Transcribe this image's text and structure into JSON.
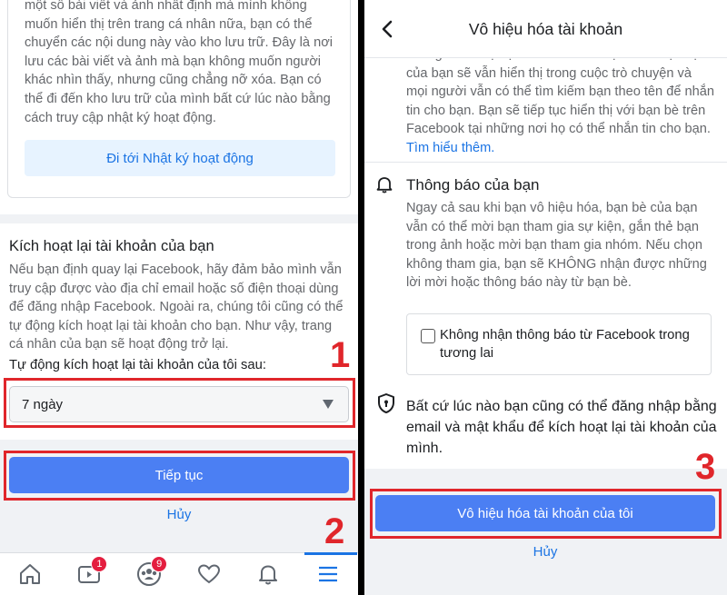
{
  "left_screen": {
    "intro_text": "một số bài viết và ảnh nhất định mà mình không muốn hiển thị trên trang cá nhân nữa, bạn có thể chuyển các nội dung này vào kho lưu trữ. Đây là nơi lưu các bài viết và ảnh mà bạn không muốn người khác nhìn thấy, nhưng cũng chẳng nỡ xóa. Bạn có thể đi đến kho lưu trữ của mình bất cứ lúc nào bằng cách truy cập nhật ký hoạt động.",
    "activity_log_button": "Đi tới Nhật ký hoạt động",
    "reactivate_title": "Kích hoạt lại tài khoản của bạn",
    "reactivate_text": "Nếu bạn định quay lại Facebook, hãy đảm bảo mình vẫn truy cập được vào địa chỉ email hoặc số điện thoại dùng để đăng nhập Facebook. Ngoài ra, chúng tôi cũng có thể tự động kích hoạt lại tài khoản cho bạn. Như vậy, trang cá nhân của bạn sẽ hoạt động trở lại.",
    "auto_reactivate_label": "Tự động kích hoạt lại tài khoản của tôi sau:",
    "selected_option": "7 ngày",
    "continue_button": "Tiếp tục",
    "cancel_link": "Hủy",
    "callout_1": "1",
    "callout_2": "2",
    "nav": {
      "watch_badge": "1",
      "groups_badge": "9"
    }
  },
  "right_screen": {
    "title": "Vô hiệu hóa tài khoản",
    "profile_text": "không kích hoạt lại tài khoản của bạn. Ảnh đại diện của bạn sẽ vẫn hiển thị trong cuộc trò chuyện và mọi người vẫn có thể tìm kiếm bạn theo tên để nhắn tin cho bạn. Bạn sẽ tiếp tục hiển thị với bạn bè trên Facebook tại những nơi họ có thể nhắn tin cho bạn. ",
    "learn_more_link": "Tìm hiểu thêm.",
    "notif_title": "Thông báo của bạn",
    "notif_text": "Ngay cả sau khi bạn vô hiệu hóa, bạn bè của bạn vẫn có thể mời bạn tham gia sự kiện, gắn thẻ bạn trong ảnh hoặc mời bạn tham gia nhóm. Nếu chọn không tham gia, bạn sẽ KHÔNG nhận được những lời mời hoặc thông báo này từ bạn bè.",
    "checkbox_label": "Không nhận thông báo từ Facebook trong tương lai",
    "login_text": "Bất cứ lúc nào bạn cũng có thể đăng nhập bằng email và mật khẩu để kích hoạt lại tài khoản của mình.",
    "deactivate_button": "Vô hiệu hóa tài khoản của tôi",
    "cancel_link": "Hủy",
    "callout_3": "3"
  },
  "colors": {
    "primary_button": "#4b7ff3",
    "link": "#1b74e4",
    "highlight": "#e0262b",
    "badge": "#e41e3f"
  },
  "icons": [
    "home-icon",
    "watch-icon",
    "groups-icon",
    "dating-heart-icon",
    "bell-icon",
    "menu-icon",
    "back-chevron-icon",
    "shield-icon",
    "dropdown-caret-icon"
  ]
}
